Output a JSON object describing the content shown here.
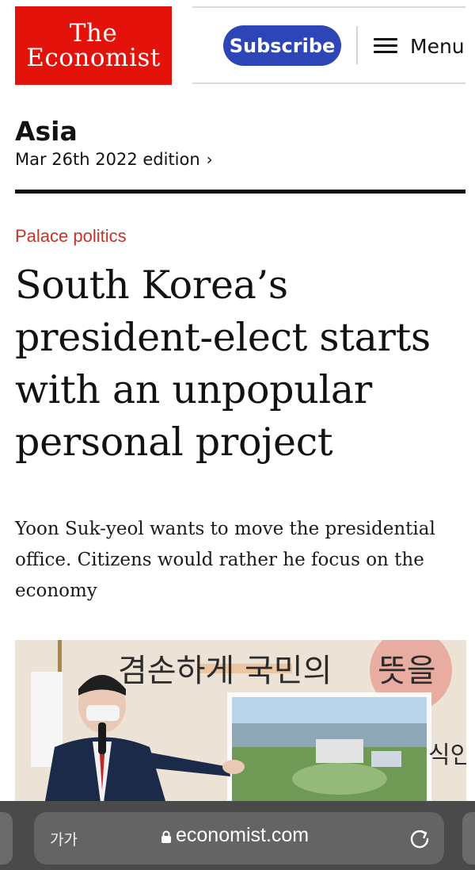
{
  "header": {
    "logo_line1": "The",
    "logo_line2": "Economist",
    "subscribe_label": "Subscribe",
    "menu_label": "Menu"
  },
  "section": {
    "title": "Asia",
    "edition": "Mar 26th 2022 edition",
    "edition_chevron": "›"
  },
  "article": {
    "kicker": "Palace politics",
    "headline": "South Korea’s president-elect starts with an unpopular personal project",
    "standfirst": "Yoon Suk-yeol wants to move the presidential office. Citizens would rather he focus on the economy"
  },
  "photo": {
    "banner_left": "겸손하게",
    "banner_mid": "국민의",
    "banner_right": "뜻을",
    "side_text": "식인"
  },
  "browser": {
    "text_size_label": "가가",
    "url": "economist.com"
  },
  "colors": {
    "brand_red": "#e3120b",
    "subscribe_blue": "#2e45b8",
    "kicker_red": "#c2352b",
    "browser_bar": "#4a4a4a"
  }
}
